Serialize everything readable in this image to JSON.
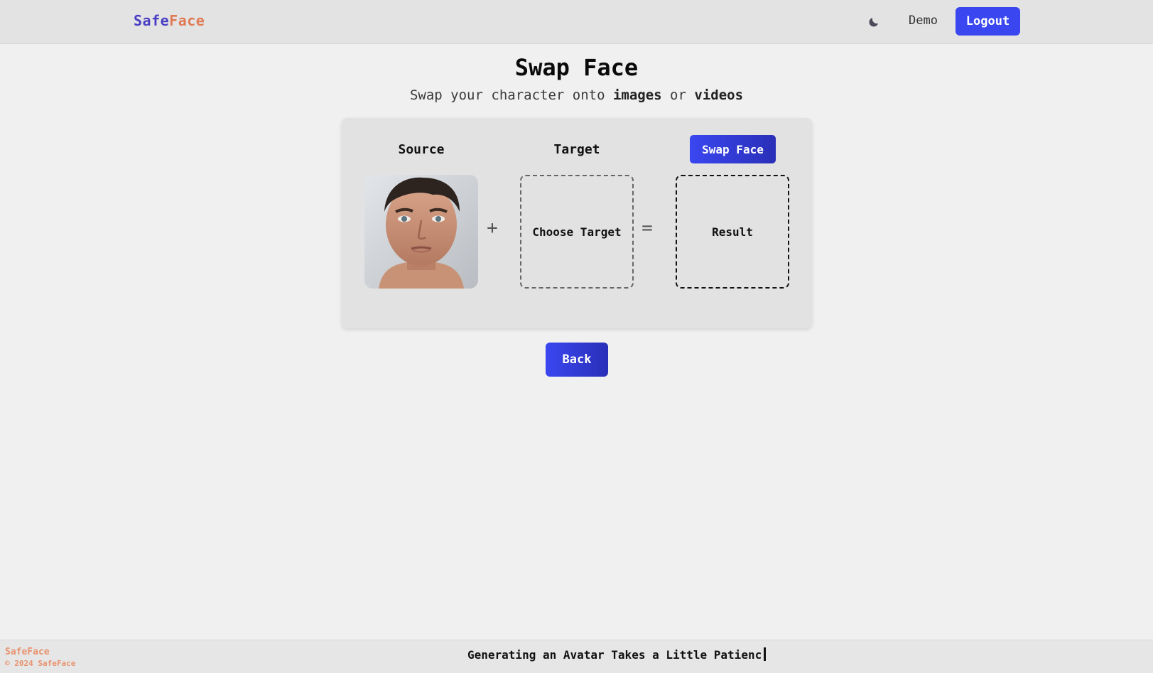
{
  "nav": {
    "brand_part1": "Safe",
    "brand_part2": "Face",
    "theme_icon": "moon-icon",
    "demo_label": "Demo",
    "logout_label": "Logout"
  },
  "header": {
    "title": "Swap Face",
    "subtitle_prefix": "Swap your character onto ",
    "subtitle_images": "images",
    "subtitle_or": " or ",
    "subtitle_videos": "videos"
  },
  "card": {
    "source_label": "Source",
    "target_label": "Target",
    "swap_button_label": "Swap Face",
    "plus_symbol": "+",
    "equals_symbol": "=",
    "choose_target_label": "Choose Target",
    "result_label": "Result"
  },
  "back_label": "Back",
  "footer": {
    "brand": "SafeFace",
    "copyright": "© 2024 SafeFace",
    "typing_text": "Generating an Avatar Takes a Little Patienc"
  },
  "colors": {
    "accent": "#3a47f0",
    "brand_blue": "#4a3fc4",
    "brand_orange": "#e07a55",
    "footer_orange": "#e8926e"
  }
}
